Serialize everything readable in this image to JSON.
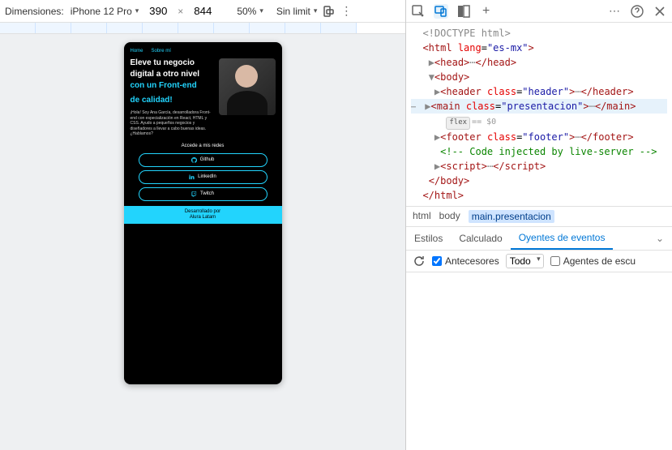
{
  "toolbar": {
    "dimensions_label": "Dimensiones:",
    "device": "iPhone 12 Pro",
    "width": "390",
    "height": "844",
    "zoom": "50%",
    "throttle": "Sin limit"
  },
  "preview": {
    "nav": {
      "home": "Home",
      "about": "Sobre mí"
    },
    "hero_line1": "Eleve tu negocio",
    "hero_line2": "digital a otro nivel",
    "hero_sub1": "con un Front-end",
    "hero_sub2": "de calidad!",
    "intro": "¡Hola! Soy Ana García, desarrolladora Front-end con especialización en React, HTML y CSS. Ayudo a pequeños negocios y diseñadores a llevar a cabo buenas ideas. ¿Hablamos?",
    "access": "Accede a mis redes",
    "btn_github": "Github",
    "btn_linkedin": "LinkedIn",
    "btn_twitch": "Twitch",
    "footer1": "Desarrollado por",
    "footer2": "Alura Latam"
  },
  "dom": {
    "doctype": "<!DOCTYPE html>",
    "html_open": "<html lang=\"es-mx\">",
    "head": "head",
    "body_open": "<body>",
    "header_tag": "header",
    "header_class": "header",
    "main_tag": "main",
    "main_class": "presentacion",
    "flex_pill": "flex",
    "eq": "== $0",
    "footer_tag": "footer",
    "footer_class": "footer",
    "comment": " Code injected by live-server ",
    "script_tag": "script",
    "body_close": "</body>",
    "html_close": "</html>"
  },
  "breadcrumb": {
    "a": "html",
    "b": "body",
    "c": "main.presentacion"
  },
  "styles_tabs": {
    "estilos": "Estilos",
    "calculado": "Calculado",
    "oyentes": "Oyentes de eventos"
  },
  "filter": {
    "antecesores": "Antecesores",
    "todo": "Todo",
    "agentes": "Agentes de escu"
  }
}
